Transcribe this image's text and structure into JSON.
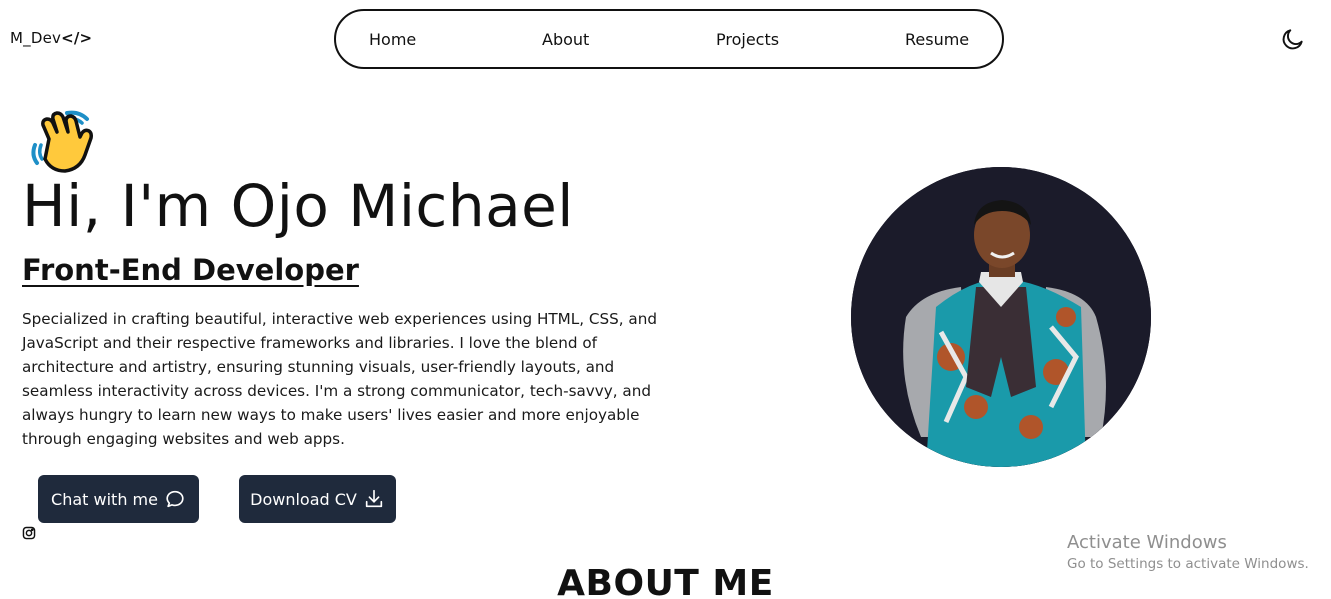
{
  "brand": {
    "logo_text": "M_Dev",
    "logo_symbol": "</>"
  },
  "nav": {
    "items": [
      {
        "label": "Home"
      },
      {
        "label": "About"
      },
      {
        "label": "Projects"
      },
      {
        "label": "Resume"
      }
    ],
    "theme_toggle_icon": "moon-icon"
  },
  "hero": {
    "wave_icon": "waving-hand-emoji",
    "title": "Hi, I'm Ojo Michael",
    "role": "Front-End Developer",
    "description": "Specialized in crafting beautiful, interactive web experiences using HTML, CSS, and JavaScript and their respective frameworks and libraries. I love the blend of architecture and artistry, ensuring stunning visuals, user-friendly layouts, and seamless interactivity across devices. I'm a strong communicator, tech-savvy, and always hungry to learn new ways to make users' lives easier and more enjoyable through engaging websites and web apps.",
    "buttons": {
      "chat_label": "Chat with me",
      "chat_icon": "chat-bubble-icon",
      "cv_label": "Download CV",
      "cv_icon": "download-icon"
    },
    "social_icon": "instagram-icon",
    "portrait_icon": "profile-photo"
  },
  "about": {
    "heading": "ABOUT ME"
  },
  "os_overlay": {
    "line1": "Activate Windows",
    "line2": "Go to Settings to activate Windows."
  },
  "colors": {
    "button_bg": "#1f2a3c",
    "text": "#111111",
    "background": "#ffffff",
    "portrait_bg": "#1b1b2a"
  }
}
